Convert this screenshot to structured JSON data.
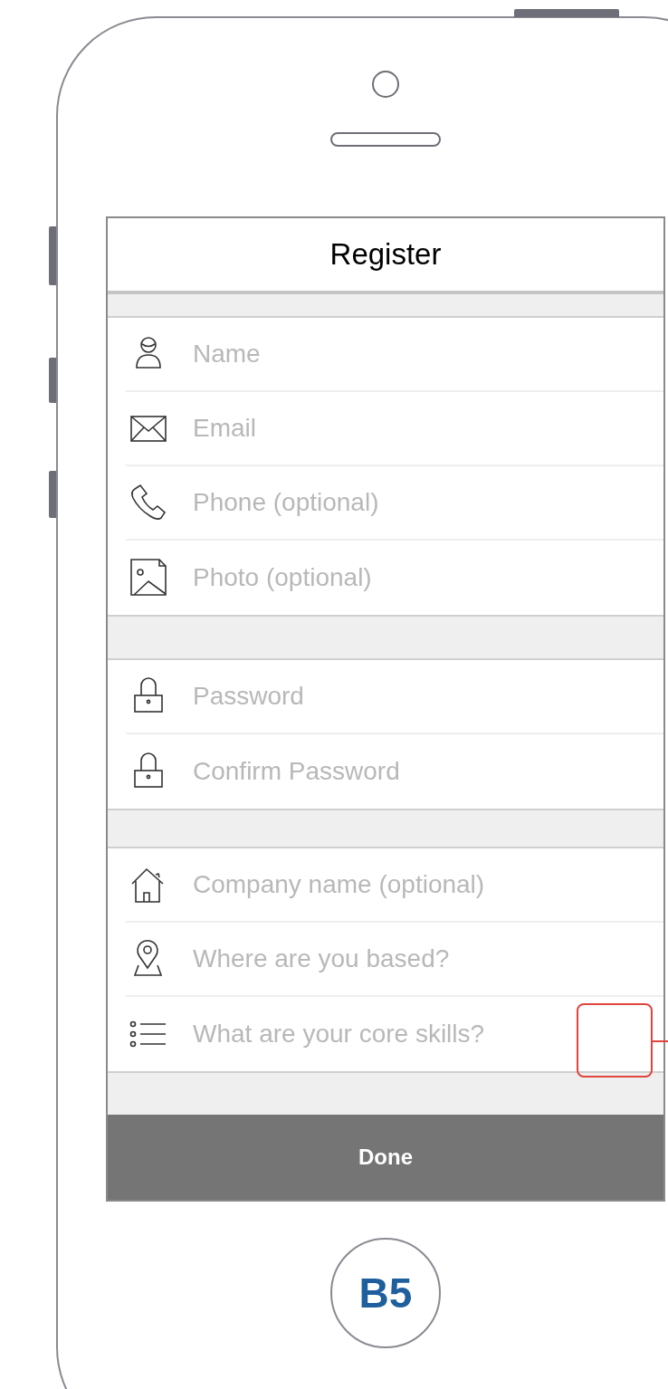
{
  "screen_title": "Register",
  "field_groups": [
    [
      {
        "kind": "person",
        "placeholder": "Name"
      },
      {
        "kind": "email",
        "placeholder": "Email"
      },
      {
        "kind": "phone",
        "placeholder": "Phone (optional)"
      },
      {
        "kind": "photo",
        "placeholder": "Photo (optional)"
      }
    ],
    [
      {
        "kind": "password",
        "placeholder": "Password"
      },
      {
        "kind": "password",
        "placeholder": "Confirm Password"
      }
    ],
    [
      {
        "kind": "company",
        "placeholder": "Company name (optional)"
      },
      {
        "kind": "location",
        "placeholder": "Where are you based?"
      },
      {
        "kind": "skills",
        "placeholder": "What are your core skills?"
      }
    ]
  ],
  "done_button": "Done",
  "home_button_label": "B5"
}
